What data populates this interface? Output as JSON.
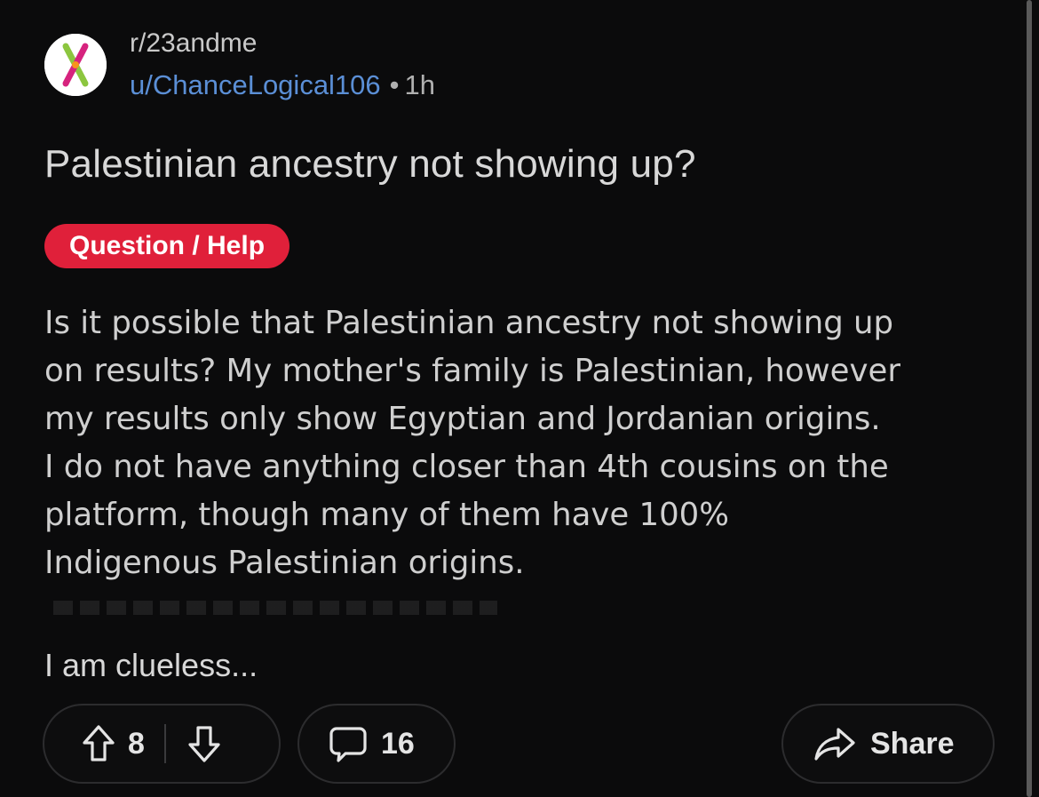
{
  "post": {
    "subreddit": "r/23andme",
    "username": "u/ChanceLogical106",
    "separator": "•",
    "time": "1h",
    "title": "Palestinian ancestry not showing up?",
    "flair": "Question / Help",
    "body_lines": [
      "Is it possible that Palestinian ancestry not showing up",
      "on results? My mother's family is Palestinian, however",
      "my results only show Egyptian and Jordanian origins.",
      "I do not have anything closer than 4th cousins on the",
      "platform, though many of them have 100%",
      "Indigenous Palestinian origins."
    ],
    "closing": "I am clueless..."
  },
  "actions": {
    "upvote_icon": "arrow-up-icon",
    "vote_count": "8",
    "downvote_icon": "arrow-down-icon",
    "comment_icon": "comment-bubble-icon",
    "comment_count": "16",
    "share_icon": "share-arrow-icon",
    "share_label": "Share"
  },
  "colors": {
    "background": "#0b0b0c",
    "flair": "#e0203a",
    "username": "#5b8fd6"
  }
}
